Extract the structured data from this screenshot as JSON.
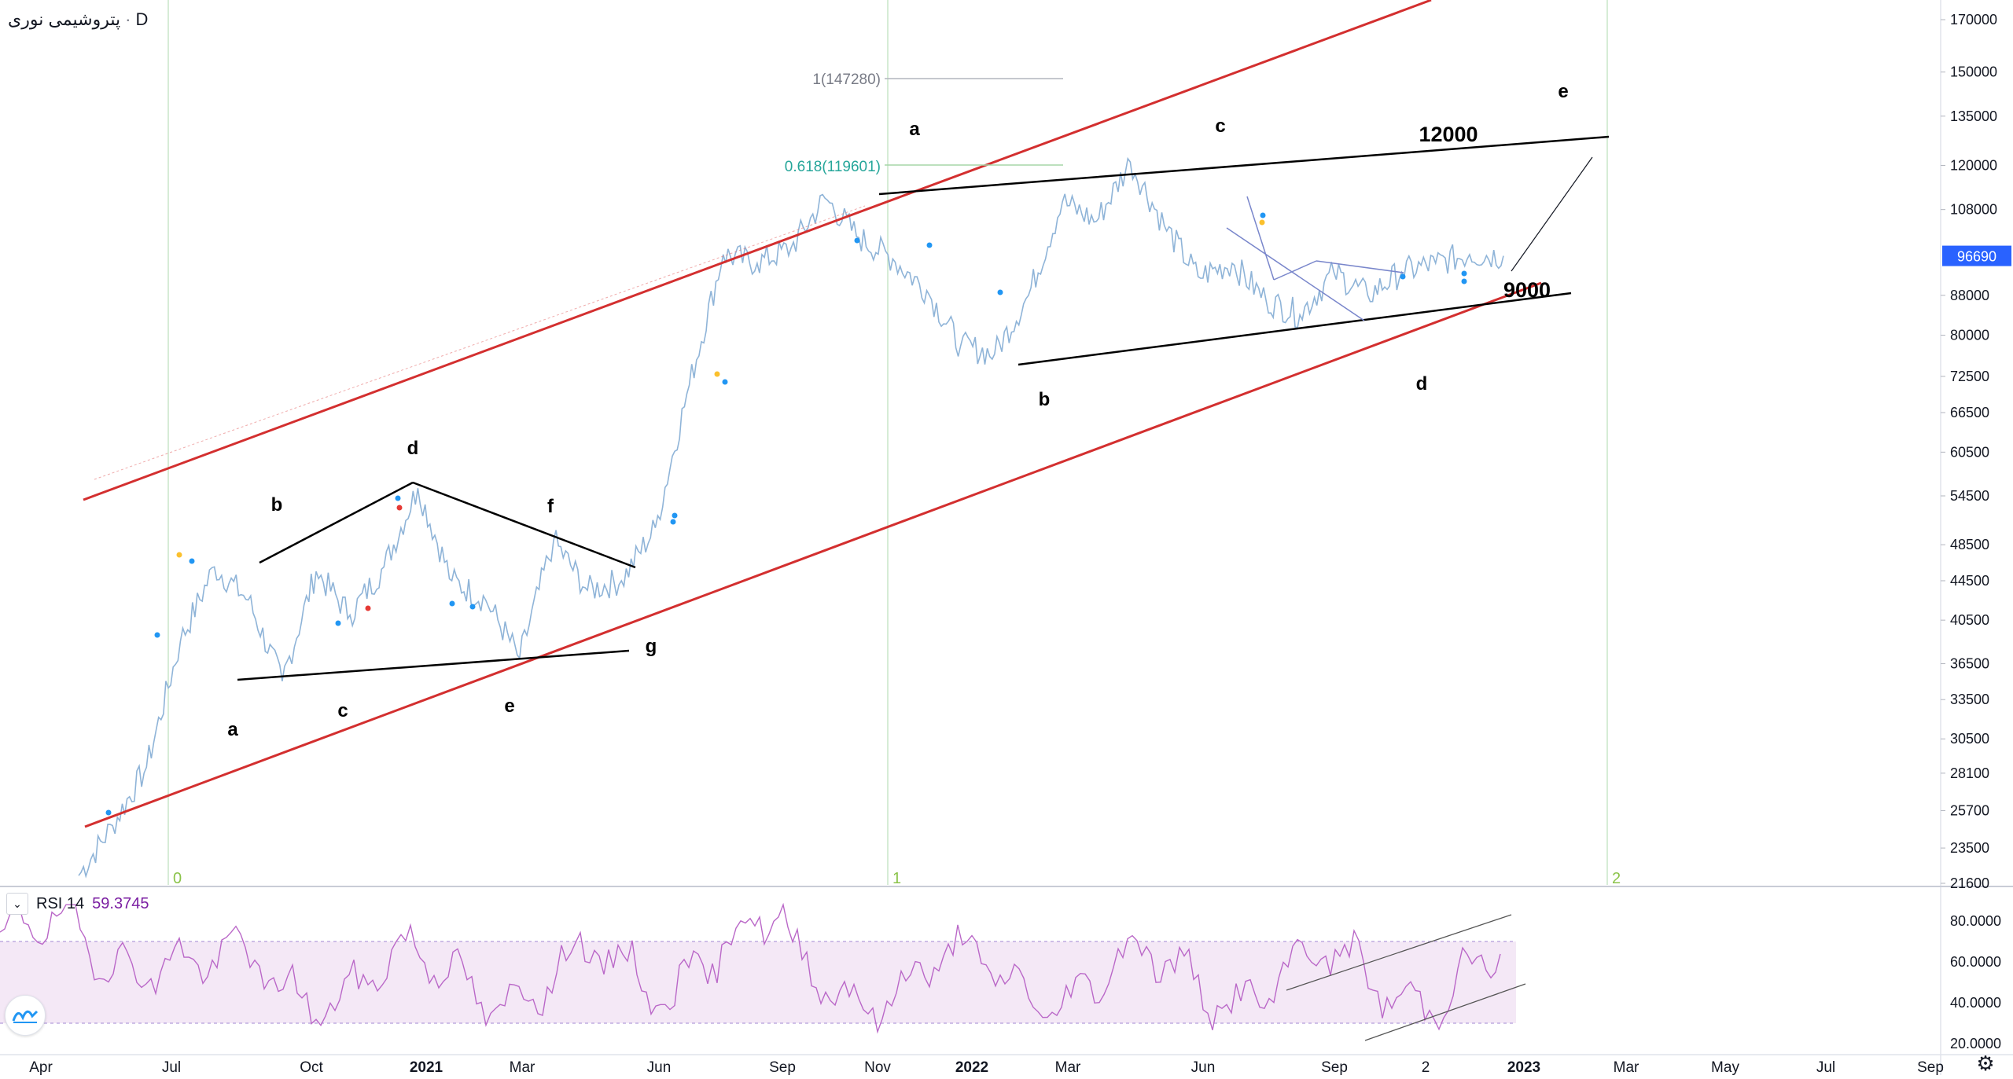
{
  "instrument": {
    "name": "پتروشیمی نوری",
    "interval": "D"
  },
  "rsi": {
    "label": "RSI 14",
    "value": "59.3745"
  },
  "price_axis": {
    "ticks": [
      "170000",
      "150000",
      "135000",
      "120000",
      "108000",
      "96690",
      "88000",
      "80000",
      "72500",
      "66500",
      "60500",
      "54500",
      "48500",
      "44500",
      "40500",
      "36500",
      "33500",
      "30500",
      "28100",
      "25700",
      "23500",
      "21600"
    ],
    "current_price": "96690"
  },
  "rsi_axis": {
    "ticks": [
      "80.0000",
      "60.0000",
      "40.0000",
      "20.0000"
    ]
  },
  "time_axis": {
    "labels": [
      "Apr",
      "Jul",
      "Oct",
      "2021",
      "Mar",
      "Jun",
      "Sep",
      "Nov",
      "2022",
      "Mar",
      "Jun",
      "Sep",
      "2",
      "2023",
      "Mar",
      "May",
      "Jul",
      "Sep"
    ]
  },
  "chart_data": {
    "type": "line",
    "series": [
      {
        "values": [
          22000,
          24800,
          28500,
          38500,
          46000,
          42500,
          35000,
          45500,
          41000,
          46000,
          55500,
          44500,
          42500,
          37000,
          49000,
          43500,
          44500,
          50500,
          71000,
          97000,
          95000,
          98500,
          111000,
          101000,
          96000,
          89000,
          78000,
          76500,
          88000,
          110000,
          105000,
          121000,
          104000,
          92000,
          95000,
          87000,
          84000,
          93000,
          88000,
          93000,
          95000,
          97000,
          96690
        ]
      }
    ],
    "y_scale": "log",
    "ylim": [
      21600,
      170000
    ],
    "fib_labels": [
      "1(147280)",
      "0.618(119601)"
    ],
    "wave_labels_main": [
      "a",
      "b",
      "c",
      "d",
      "e"
    ],
    "wave_labels_left": [
      "a",
      "b",
      "c",
      "d",
      "e",
      "f",
      "g"
    ],
    "price_targets": [
      "12000",
      "9000"
    ],
    "cycle_markers": [
      "0",
      "1",
      "2"
    ],
    "rsi_band": [
      30,
      70
    ],
    "rsi_ylim": [
      20,
      90
    ]
  }
}
